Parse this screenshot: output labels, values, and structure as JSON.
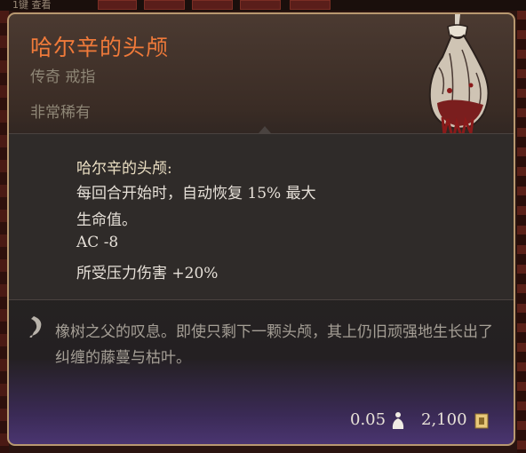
{
  "background": {
    "hotkey_label": "1键 查看"
  },
  "tooltip": {
    "name": "哈尔辛的头颅",
    "type": "传奇 戒指",
    "rarity": "非常稀有",
    "name_color": "#f07a3a",
    "icon": "severed-head-in-sack-icon"
  },
  "effects": {
    "title": "哈尔辛的头颅:",
    "lines": [
      "每回合开始时，自动恢复 15% 最大",
      "生命值。",
      "AC -8",
      "所受压力伤害 +20%"
    ]
  },
  "flavor": {
    "icon": "quill-icon",
    "text": "橡树之父的叹息。即使只剩下一颗头颅，其上仍旧顽强地生长出了纠缠的藤蔓与枯叶。"
  },
  "footer": {
    "weight": "0.05",
    "weight_icon": "weight-icon",
    "price": "2,100",
    "price_icon": "coin-icon"
  }
}
